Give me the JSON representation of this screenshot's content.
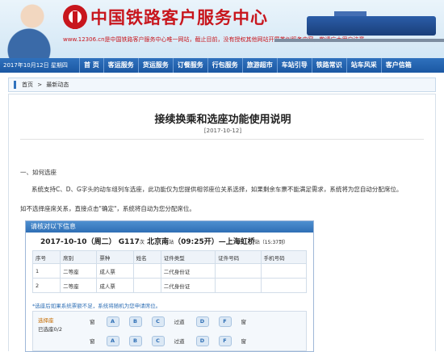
{
  "header": {
    "site_title": "中国铁路客户服务中心",
    "notice": "www.12306.cn是中国铁路客户服务中心唯一网站，截止目前，没有授权其他网站开展类似服务内容，敬请广大用户注意。"
  },
  "nav": {
    "date": "2017年10月12日 星期四",
    "items": [
      "首 页",
      "客运服务",
      "货运服务",
      "订餐服务",
      "行包服务",
      "旅游超市",
      "车站引导",
      "铁路常识",
      "站车风采",
      "客户信箱"
    ]
  },
  "breadcrumb": {
    "home": "首页",
    "separator": ">",
    "current": "最新动态"
  },
  "article": {
    "title": "接续换乘和选座功能使用说明",
    "date": "[2017-10-12]",
    "section_heading": "一、如何选座",
    "paragraph1": "系统支持C、D、G字头的动车组列车选座，此功能仅为您提供相邻座位关系选择，如果剩余车票不能满足需求，系统将为您自动分配席位。",
    "paragraph2": "如不选择座席关系，直接点击\"确定\"，系统将自动为您分配席位。"
  },
  "screenshot": {
    "header": "请核对以下信息",
    "route": {
      "date": "2017-10-10（周二）",
      "train": "G117",
      "train_suffix": "次",
      "from": "北京南",
      "from_suffix": "站",
      "depart": "（09:25开）",
      "arrow": "—",
      "to": "上海虹桥",
      "to_suffix": "站",
      "duration": "（15:37到）"
    },
    "table": {
      "headers": [
        "序号",
        "席别",
        "票种",
        "姓名",
        "证件类型",
        "证件号码",
        "手机号码"
      ],
      "rows": [
        [
          "1",
          "二等座",
          "成人票",
          "",
          "二代身份证",
          "",
          ""
        ],
        [
          "2",
          "二等座",
          "成人票",
          "",
          "二代身份证",
          "",
          ""
        ]
      ]
    },
    "tip": "*选座后如果系统票额不足，系统将随机为您申请席位。",
    "seat_panel": {
      "label": "选择座",
      "selected": "已选座0/2",
      "rows": [
        [
          "窗",
          "A",
          "B",
          "C",
          "过道",
          "D",
          "F",
          "窗"
        ],
        [
          "窗",
          "A",
          "B",
          "C",
          "过道",
          "D",
          "F",
          "窗"
        ]
      ]
    }
  }
}
